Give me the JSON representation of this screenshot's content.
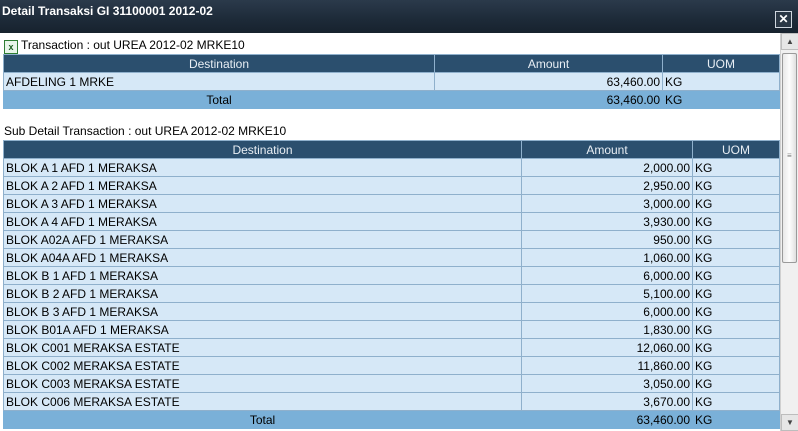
{
  "window": {
    "title": "Detail Transaksi GI 31100001 2012-02",
    "close_label": "✕"
  },
  "transaction": {
    "label": "Transaction : out UREA 2012-02 MRKE10",
    "headers": [
      "Destination",
      "Amount",
      "UOM"
    ],
    "rows": [
      {
        "destination": "AFDELING 1 MRKE",
        "amount": "63,460.00",
        "uom": "KG"
      }
    ],
    "total": {
      "label": "Total",
      "amount": "63,460.00",
      "uom": "KG"
    }
  },
  "sub_detail": {
    "label": "Sub Detail Transaction : out UREA 2012-02 MRKE10",
    "headers": [
      "Destination",
      "Amount",
      "UOM"
    ],
    "rows": [
      {
        "destination": "BLOK A 1 AFD 1 MERAKSA",
        "amount": "2,000.00",
        "uom": "KG"
      },
      {
        "destination": "BLOK A 2 AFD 1 MERAKSA",
        "amount": "2,950.00",
        "uom": "KG"
      },
      {
        "destination": "BLOK A 3 AFD 1 MERAKSA",
        "amount": "3,000.00",
        "uom": "KG"
      },
      {
        "destination": "BLOK A 4 AFD 1 MERAKSA",
        "amount": "3,930.00",
        "uom": "KG"
      },
      {
        "destination": "BLOK A02A AFD 1 MERAKSA",
        "amount": "950.00",
        "uom": "KG"
      },
      {
        "destination": "BLOK A04A AFD 1 MERAKSA",
        "amount": "1,060.00",
        "uom": "KG"
      },
      {
        "destination": "BLOK B 1 AFD 1 MERAKSA",
        "amount": "6,000.00",
        "uom": "KG"
      },
      {
        "destination": "BLOK B 2 AFD 1 MERAKSA",
        "amount": "5,100.00",
        "uom": "KG"
      },
      {
        "destination": "BLOK B 3 AFD 1 MERAKSA",
        "amount": "6,000.00",
        "uom": "KG"
      },
      {
        "destination": "BLOK B01A AFD 1 MERAKSA",
        "amount": "1,830.00",
        "uom": "KG"
      },
      {
        "destination": "BLOK C001 MERAKSA ESTATE",
        "amount": "12,060.00",
        "uom": "KG"
      },
      {
        "destination": "BLOK C002 MERAKSA ESTATE",
        "amount": "11,860.00",
        "uom": "KG"
      },
      {
        "destination": "BLOK C003 MERAKSA ESTATE",
        "amount": "3,050.00",
        "uom": "KG"
      },
      {
        "destination": "BLOK C006 MERAKSA ESTATE",
        "amount": "3,670.00",
        "uom": "KG"
      }
    ],
    "total": {
      "label": "Total",
      "amount": "63,460.00",
      "uom": "KG"
    }
  },
  "icons": {
    "export": "excel-export-icon"
  },
  "colors": {
    "header_bg": "#2b4f6e",
    "row_bg": "#d6e8f7",
    "total_bg": "#7ab0d8",
    "titlebar_bg": "#1d2a38"
  }
}
